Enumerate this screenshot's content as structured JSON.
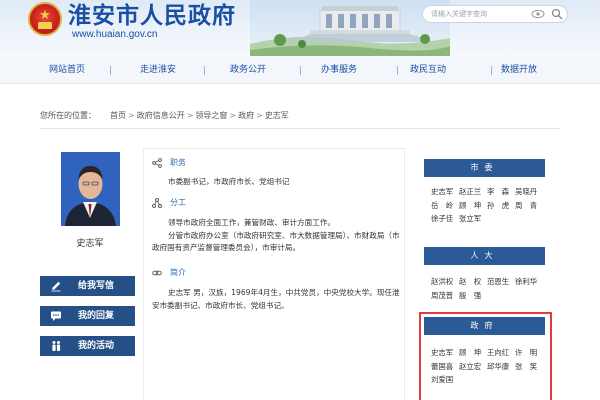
{
  "header": {
    "site_title": "淮安市人民政府",
    "site_url": "www.huaian.gov.cn",
    "search_placeholder": "请输入关键字查询"
  },
  "nav": {
    "items": [
      {
        "label": "网站首页"
      },
      {
        "label": "走进淮安"
      },
      {
        "label": "政务公开"
      },
      {
        "label": "办事服务"
      },
      {
        "label": "政民互动"
      },
      {
        "label": "数据开放"
      }
    ]
  },
  "breadcrumb": {
    "prefix": "您所在的位置：",
    "items": [
      "首页",
      "政府信息公开",
      "领导之窗",
      "政府",
      "史志军"
    ]
  },
  "profile": {
    "name": "史志军",
    "buttons": [
      {
        "label": "给我写信",
        "icon": "pencil-icon"
      },
      {
        "label": "我的回复",
        "icon": "chat-icon"
      },
      {
        "label": "我的活动",
        "icon": "activity-icon"
      }
    ],
    "duty": {
      "heading": "职务",
      "text": "市委副书记，市政府市长、党组书记"
    },
    "division": {
      "heading": "分工",
      "line1": "领导市政府全面工作，兼管财政、审计方面工作。",
      "line2": "分管市政府办公室（市政府研究室、市大数据管理局）、市财政局（市政府国有资产监督管理委员会），市审计局。"
    },
    "bio": {
      "heading": "简介",
      "text": "史志军 男，汉族，1969年4月生，中共党员，中央党校大学。现任淮安市委副书记、市政府市长、党组书记。"
    }
  },
  "leaders": {
    "groups": [
      {
        "title": "市委",
        "rows": [
          [
            "史志军",
            "赵正兰",
            "李　森",
            "吴晓丹"
          ],
          [
            "岳　岭",
            "顾　坤",
            "孙　虎",
            "周　青"
          ],
          [
            "徐子佳",
            "张立军"
          ]
        ]
      },
      {
        "title": "人大",
        "rows": [
          [
            "赵洪权",
            "赵　权",
            "范恩生",
            "徐利华"
          ],
          [
            "周茂普",
            "殷　强"
          ]
        ]
      },
      {
        "title": "政府",
        "rows": [
          [
            "史志军",
            "顾　坤",
            "王向红",
            "许　明"
          ],
          [
            "蕾国喜",
            "赵立宏",
            "邱华康",
            "张　笑"
          ],
          [
            "刘爱国"
          ]
        ]
      }
    ]
  },
  "colors": {
    "brand_blue": "#1a4fa3",
    "band_blue": "#2b5a97",
    "button_blue": "#244f87",
    "highlight_red": "#e23b3b"
  }
}
